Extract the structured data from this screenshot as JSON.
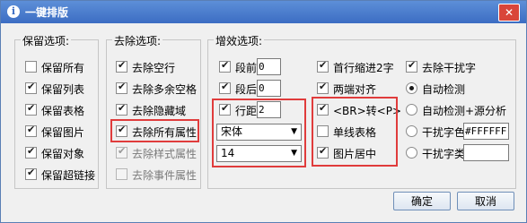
{
  "window": {
    "title": "一键排版",
    "close_symbol": "✕"
  },
  "keep": {
    "title": "保留选项:",
    "items": [
      {
        "label": "保留所有",
        "checked": false
      },
      {
        "label": "保留列表",
        "checked": true
      },
      {
        "label": "保留表格",
        "checked": true
      },
      {
        "label": "保留图片",
        "checked": true
      },
      {
        "label": "保留对象",
        "checked": true
      },
      {
        "label": "保留超链接",
        "checked": true
      }
    ]
  },
  "remove": {
    "title": "去除选项:",
    "items": [
      {
        "label": "去除空行",
        "checked": true,
        "disabled": false
      },
      {
        "label": "去除多余空格",
        "checked": true,
        "disabled": false
      },
      {
        "label": "去除隐藏域",
        "checked": true,
        "disabled": false
      },
      {
        "label": "去除所有属性",
        "checked": true,
        "disabled": false
      },
      {
        "label": "去除样式属性",
        "checked": true,
        "disabled": true
      },
      {
        "label": "去除事件属性",
        "checked": false,
        "disabled": true
      }
    ]
  },
  "enhance": {
    "title": "增效选项:",
    "before": {
      "label": "段前",
      "value": "0",
      "checked": true
    },
    "after": {
      "label": "段后",
      "value": "0",
      "checked": true
    },
    "line_spacing": {
      "label": "行距",
      "value": "2",
      "checked": true
    },
    "font": {
      "value": "宋体",
      "arrow": "▼"
    },
    "size": {
      "value": "14",
      "arrow": "▼"
    },
    "mid": [
      {
        "label": "首行缩进2字",
        "checked": true
      },
      {
        "label": "两端对齐",
        "checked": true
      },
      {
        "label": "<BR>转<P>",
        "checked": true
      },
      {
        "label": "单线表格",
        "checked": false
      },
      {
        "label": "图片居中",
        "checked": true
      }
    ],
    "interference": {
      "label": "去除干扰字",
      "checked": true
    },
    "radios": [
      {
        "label": "自动检测",
        "checked": true
      },
      {
        "label": "自动检测+源分析",
        "checked": false
      },
      {
        "label": "干扰字色",
        "checked": false,
        "value": "#FFFFFF"
      },
      {
        "label": "干扰字类",
        "checked": false,
        "value": ""
      }
    ]
  },
  "buttons": {
    "ok": "确定",
    "cancel": "取消"
  },
  "colors": {
    "title_bar": "#3c6dc3",
    "highlight": "#e03c3c"
  }
}
